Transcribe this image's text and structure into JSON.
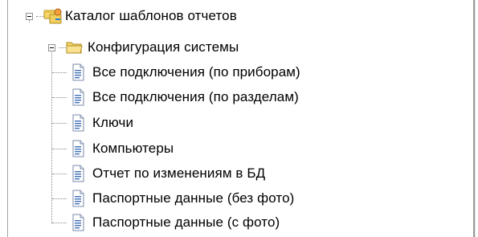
{
  "tree": {
    "root": {
      "label": "Каталог шаблонов отчетов",
      "icon": "report-catalog-icon",
      "expanded": true
    },
    "folder": {
      "label": "Конфигурация системы",
      "icon": "folder-open-icon",
      "expanded": true
    },
    "items": [
      {
        "label": "Все подключения (по приборам)",
        "icon": "report-document-icon"
      },
      {
        "label": "Все подключения (по разделам)",
        "icon": "report-document-icon"
      },
      {
        "label": "Ключи",
        "icon": "report-document-icon"
      },
      {
        "label": "Компьютеры",
        "icon": "report-document-icon"
      },
      {
        "label": "Отчет по изменениям в БД",
        "icon": "report-document-icon"
      },
      {
        "label": "Паспортные данные (без фото)",
        "icon": "report-document-icon"
      },
      {
        "label": "Паспортные данные (с фото)",
        "icon": "report-document-icon"
      }
    ]
  },
  "colors": {
    "tree_lines": "#8a8a8a",
    "folder_yellow": "#f5d76a",
    "document_blue": "#3f6fb5"
  }
}
